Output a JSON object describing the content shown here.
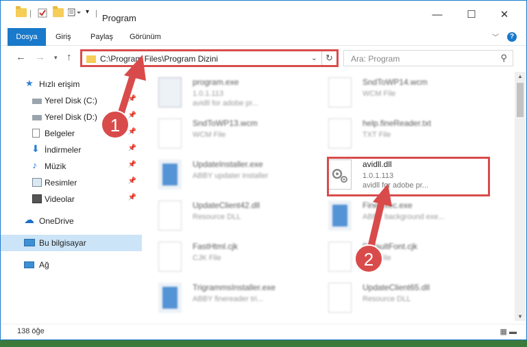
{
  "titlebar": {
    "title": "Program",
    "minimize": "—",
    "maximize": "☐",
    "close": "✕"
  },
  "ribbon": {
    "tabs": [
      "Dosya",
      "Giriş",
      "Paylaş",
      "Görünüm"
    ],
    "active": "Dosya",
    "help": "?"
  },
  "nav": {
    "address": "C:\\Program Files\\Program Dizini",
    "search_placeholder": "Ara: Program"
  },
  "sidebar": {
    "items": [
      {
        "label": "Hızlı erişim",
        "icon": "star-icon",
        "pinned": false
      },
      {
        "label": "Yerel Disk (C:)",
        "icon": "drive-icon",
        "pinned": true
      },
      {
        "label": "Yerel Disk (D:)",
        "icon": "drive-icon",
        "pinned": true
      },
      {
        "label": "Belgeler",
        "icon": "documents-icon",
        "pinned": true
      },
      {
        "label": "İndirmeler",
        "icon": "download-icon",
        "pinned": true
      },
      {
        "label": "Müzik",
        "icon": "music-icon",
        "pinned": true
      },
      {
        "label": "Resimler",
        "icon": "pictures-icon",
        "pinned": true
      },
      {
        "label": "Videolar",
        "icon": "videos-icon",
        "pinned": true
      },
      {
        "label": "OneDrive",
        "icon": "cloud-icon",
        "pinned": false
      },
      {
        "label": "Bu bilgisayar",
        "icon": "computer-icon",
        "pinned": false
      },
      {
        "label": "Ağ",
        "icon": "network-icon",
        "pinned": false
      }
    ],
    "selected": "Bu bilgisayar"
  },
  "files": {
    "left": [
      {
        "name": "program.exe",
        "type": "1.0.1.113",
        "desc": "avidll for adobe pr..."
      },
      {
        "name": "SndToWP13.wcm",
        "type": "WCM File",
        "desc": ""
      },
      {
        "name": "UpdateInstaller.exe",
        "type": "ABBY updater installer",
        "desc": ""
      },
      {
        "name": "UpdateClient42.dll",
        "type": "Resource DLL",
        "desc": ""
      },
      {
        "name": "FastHtml.cjk",
        "type": "CJK File",
        "desc": ""
      },
      {
        "name": "TrigrammsInstaller.exe",
        "type": "ABBY finereader tri...",
        "desc": ""
      }
    ],
    "right": [
      {
        "name": "SndToWP14.wcm",
        "type": "WCM File",
        "desc": ""
      },
      {
        "name": "help.fineReader.txt",
        "type": "TXT File",
        "desc": ""
      },
      {
        "name": "avidll.dll",
        "type": "1.0.1.113",
        "desc": "avidll for adobe pr..."
      },
      {
        "name": "FineExec.exe",
        "type": "ABBY background exe...",
        "desc": ""
      },
      {
        "name": "DefaultFont.cjk",
        "type": "CJK File",
        "desc": ""
      },
      {
        "name": "UpdateClient65.dll",
        "type": "Resource DLL",
        "desc": ""
      }
    ]
  },
  "status": {
    "count": "138 öğe"
  },
  "annotations": {
    "step1": "1",
    "step2": "2",
    "color": "#d94b4b"
  }
}
